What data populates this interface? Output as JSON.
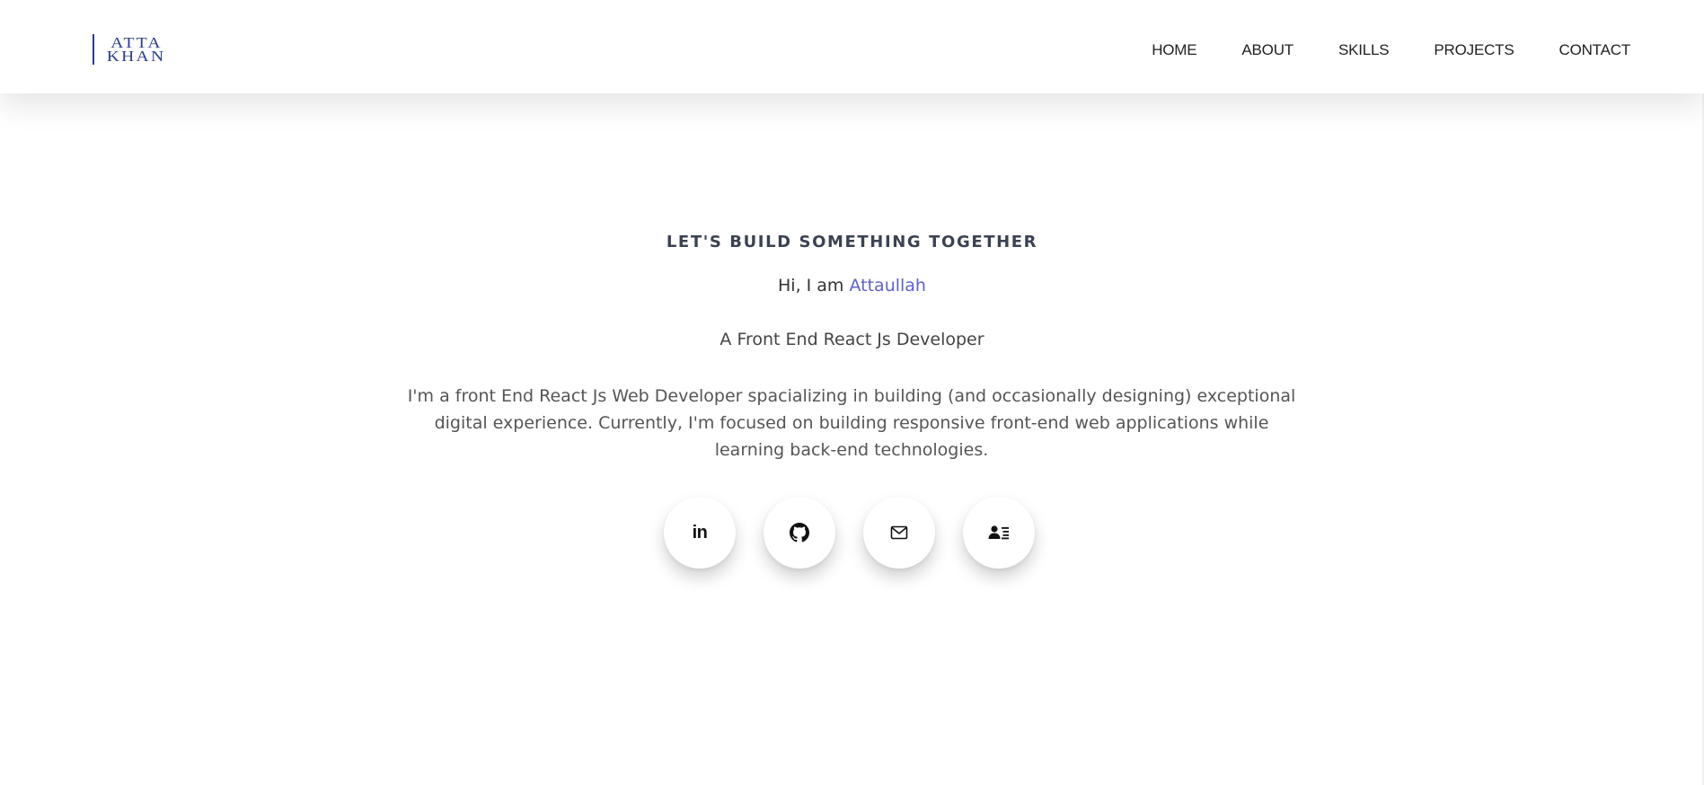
{
  "header": {
    "logo": {
      "line1": "ATTA",
      "line2": "KHAN"
    },
    "nav": [
      {
        "label": "HOME"
      },
      {
        "label": "ABOUT"
      },
      {
        "label": "SKILLS"
      },
      {
        "label": "PROJECTS"
      },
      {
        "label": "CONTACT"
      }
    ]
  },
  "hero": {
    "eyebrow": "LET'S BUILD SOMETHING TOGETHER",
    "greeting_prefix": "Hi, I am ",
    "greeting_name": "Attaullah",
    "role": "A Front End React Js Developer",
    "bio": "I'm a front End React Js Web Developer spacializing in building (and occasionally designing) exceptional digital experience. Currently, I'm focused on building responsive front-end web applications while learning back-end technologies."
  },
  "socials": [
    {
      "icon": "linkedin-icon",
      "glyph": "in"
    },
    {
      "icon": "github-icon"
    },
    {
      "icon": "mail-icon"
    },
    {
      "icon": "contact-card-icon"
    }
  ],
  "colors": {
    "accent": "#6062c8",
    "logo": "#2b3f87",
    "heading": "#3b4252",
    "body_text": "#555555"
  }
}
